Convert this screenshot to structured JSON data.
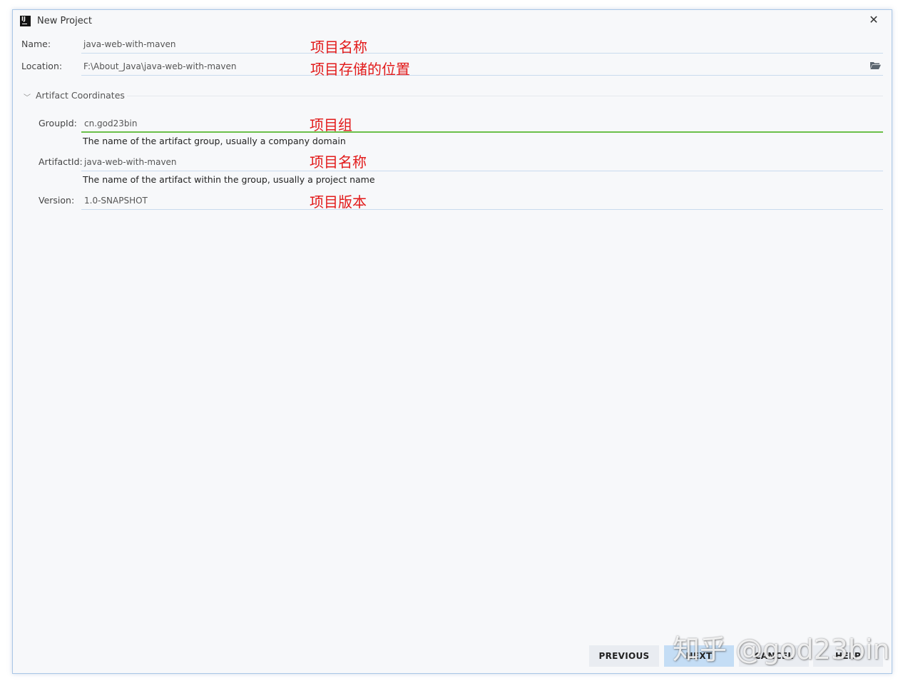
{
  "window": {
    "title": "New Project",
    "close_glyph": "✕"
  },
  "fields": {
    "name": {
      "label": "Name:",
      "value": "java-web-with-maven",
      "annotation": "项目名称"
    },
    "location": {
      "label": "Location:",
      "value": "F:\\About_Java\\java-web-with-maven",
      "annotation": "项目存储的位置"
    }
  },
  "artifact": {
    "section_title": "Artifact Coordinates",
    "group_id": {
      "label": "GroupId:",
      "value": "cn.god23bin",
      "annotation": "项目组",
      "hint": "The name of the artifact group, usually a company domain"
    },
    "artifact_id": {
      "label": "ArtifactId:",
      "value": "java-web-with-maven",
      "annotation": "项目名称",
      "hint": "The name of the artifact within the group, usually a project name"
    },
    "version": {
      "label": "Version:",
      "value": "1.0-SNAPSHOT",
      "annotation": "项目版本"
    }
  },
  "buttons": {
    "previous": "PREVIOUS",
    "next": "NEXT",
    "cancel": "CANCEL",
    "help": "HELP"
  },
  "watermark": "知乎 @god23bin",
  "icons": {
    "app": "intellij-icon",
    "folder": "folder-open-icon",
    "chevron": "chevron-down-icon",
    "close": "close-icon"
  },
  "colors": {
    "annotation": "#e21a1a",
    "active_field": "#6cc04a",
    "primary_button": "#c4ddf5"
  }
}
